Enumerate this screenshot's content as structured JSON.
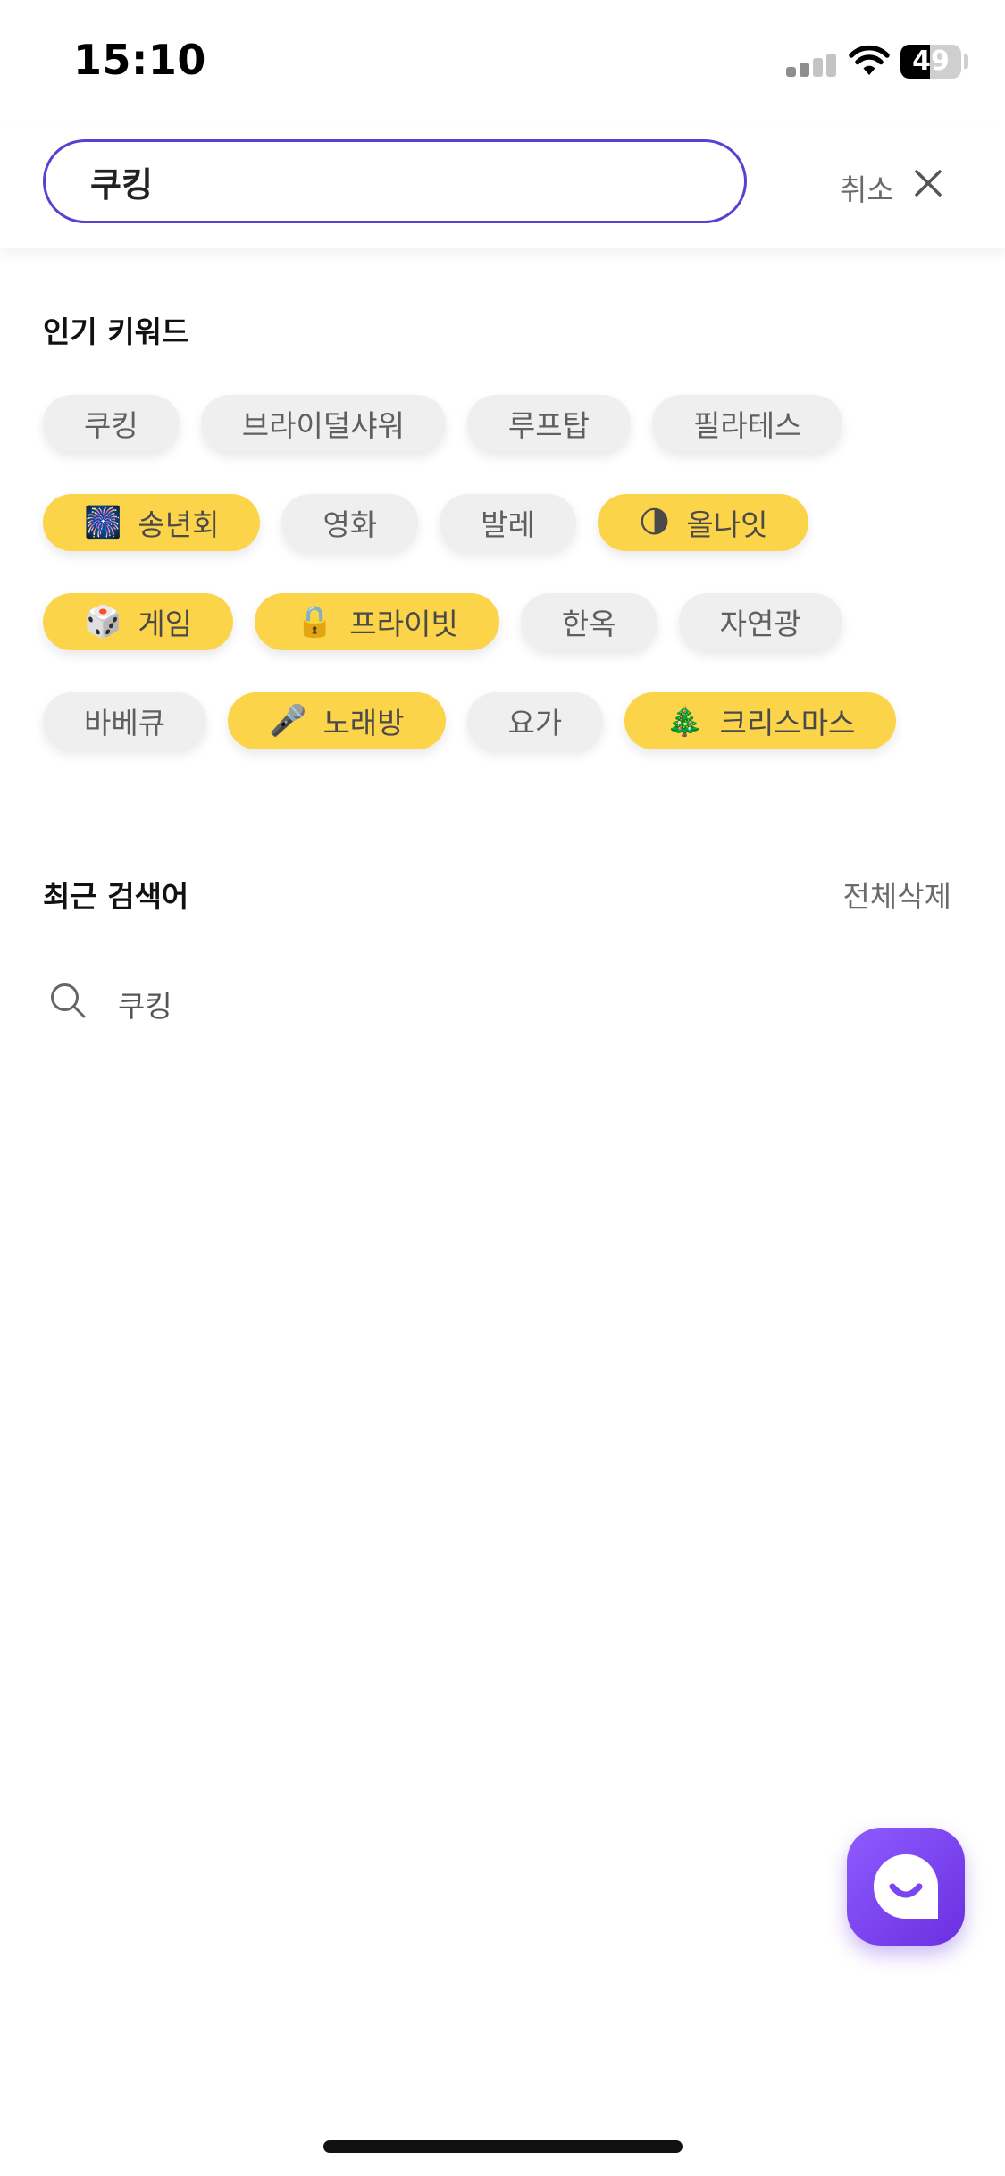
{
  "status_bar": {
    "time": "15:10",
    "battery_level": "49",
    "battery_fraction": 0.49,
    "signal_icon": "cellular-signal-icon",
    "wifi_icon": "wifi-icon"
  },
  "search": {
    "query": "쿠킹",
    "cancel_label": "취소",
    "close_icon": "close-icon"
  },
  "popular": {
    "title": "인기 키워드",
    "rows": [
      [
        {
          "label": "쿠킹",
          "highlighted": false,
          "emoji": ""
        },
        {
          "label": "브라이덜샤워",
          "highlighted": false,
          "emoji": ""
        },
        {
          "label": "루프탑",
          "highlighted": false,
          "emoji": ""
        },
        {
          "label": "필라테스",
          "highlighted": false,
          "emoji": ""
        }
      ],
      [
        {
          "label": "송년회",
          "highlighted": true,
          "emoji": "🎆"
        },
        {
          "label": "영화",
          "highlighted": false,
          "emoji": ""
        },
        {
          "label": "발레",
          "highlighted": false,
          "emoji": ""
        },
        {
          "label": "올나잇",
          "highlighted": true,
          "emoji": "🌗"
        }
      ],
      [
        {
          "label": "게임",
          "highlighted": true,
          "emoji": "🎲"
        },
        {
          "label": "프라이빗",
          "highlighted": true,
          "emoji": "🔒"
        },
        {
          "label": "한옥",
          "highlighted": false,
          "emoji": ""
        },
        {
          "label": "자연광",
          "highlighted": false,
          "emoji": ""
        }
      ],
      [
        {
          "label": "바베큐",
          "highlighted": false,
          "emoji": ""
        },
        {
          "label": "노래방",
          "highlighted": true,
          "emoji": "🎤"
        },
        {
          "label": "요가",
          "highlighted": false,
          "emoji": ""
        },
        {
          "label": "크리스마스",
          "highlighted": true,
          "emoji": "🎄"
        }
      ]
    ]
  },
  "recent": {
    "title": "최근 검색어",
    "clear_all_label": "전체삭제",
    "items": [
      {
        "text": "쿠킹",
        "icon": "search-icon"
      }
    ]
  },
  "chat_button": {
    "icon": "chat-icon"
  },
  "colors": {
    "accent": "#5b3fd0",
    "chip_highlight": "#fbd44a",
    "chip_default": "#efefef",
    "fab": "#7b45f0"
  }
}
